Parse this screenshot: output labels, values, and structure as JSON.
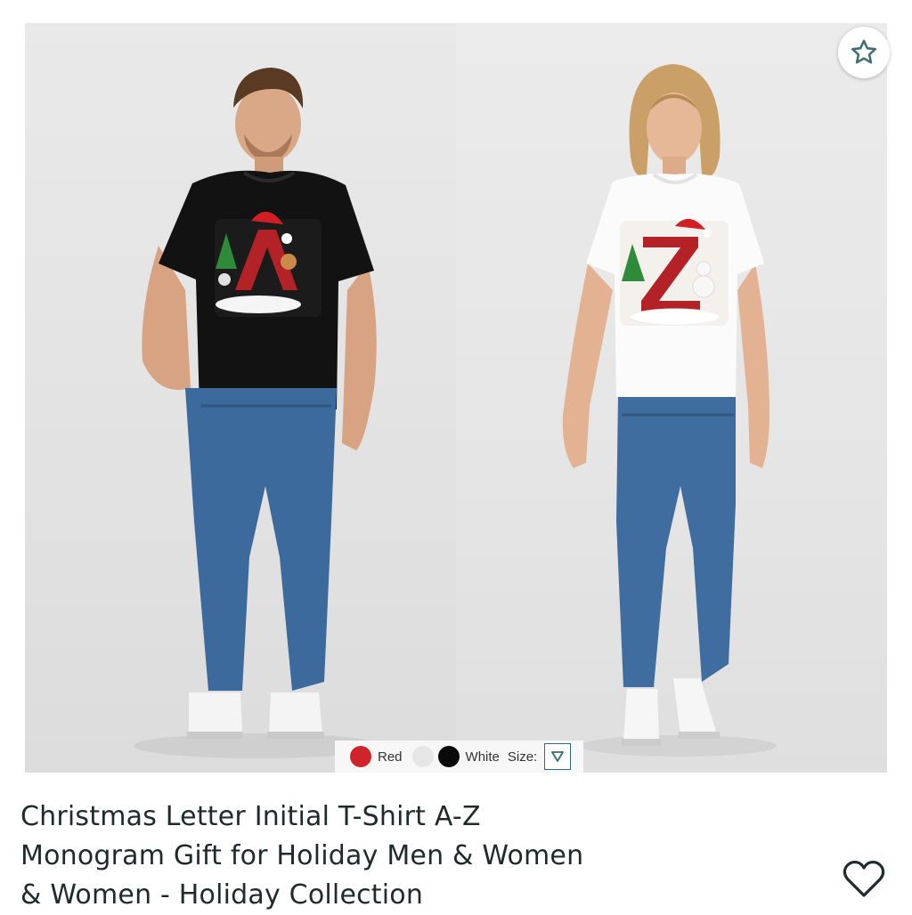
{
  "product": {
    "title_lines": [
      "Christmas Letter Initial T-Shirt A-Z",
      "Monogram Gift for Holiday Men & Women",
      "& Women - Holiday Collection"
    ]
  },
  "image": {
    "favorite_icon": "star-outline-icon"
  },
  "variants": {
    "colors": [
      {
        "label": "Red",
        "hex": "#d0232b"
      },
      {
        "label": "",
        "hex": "#e6e6e6"
      },
      {
        "label": "White",
        "hex": "#0a0a0a"
      }
    ],
    "size_label": "Size:",
    "size_icon": "triangle-down-icon"
  },
  "wishlist_icon": "heart-outline-icon",
  "colors": {
    "title": "#1f2a2a",
    "accent": "#2f6f6f"
  }
}
